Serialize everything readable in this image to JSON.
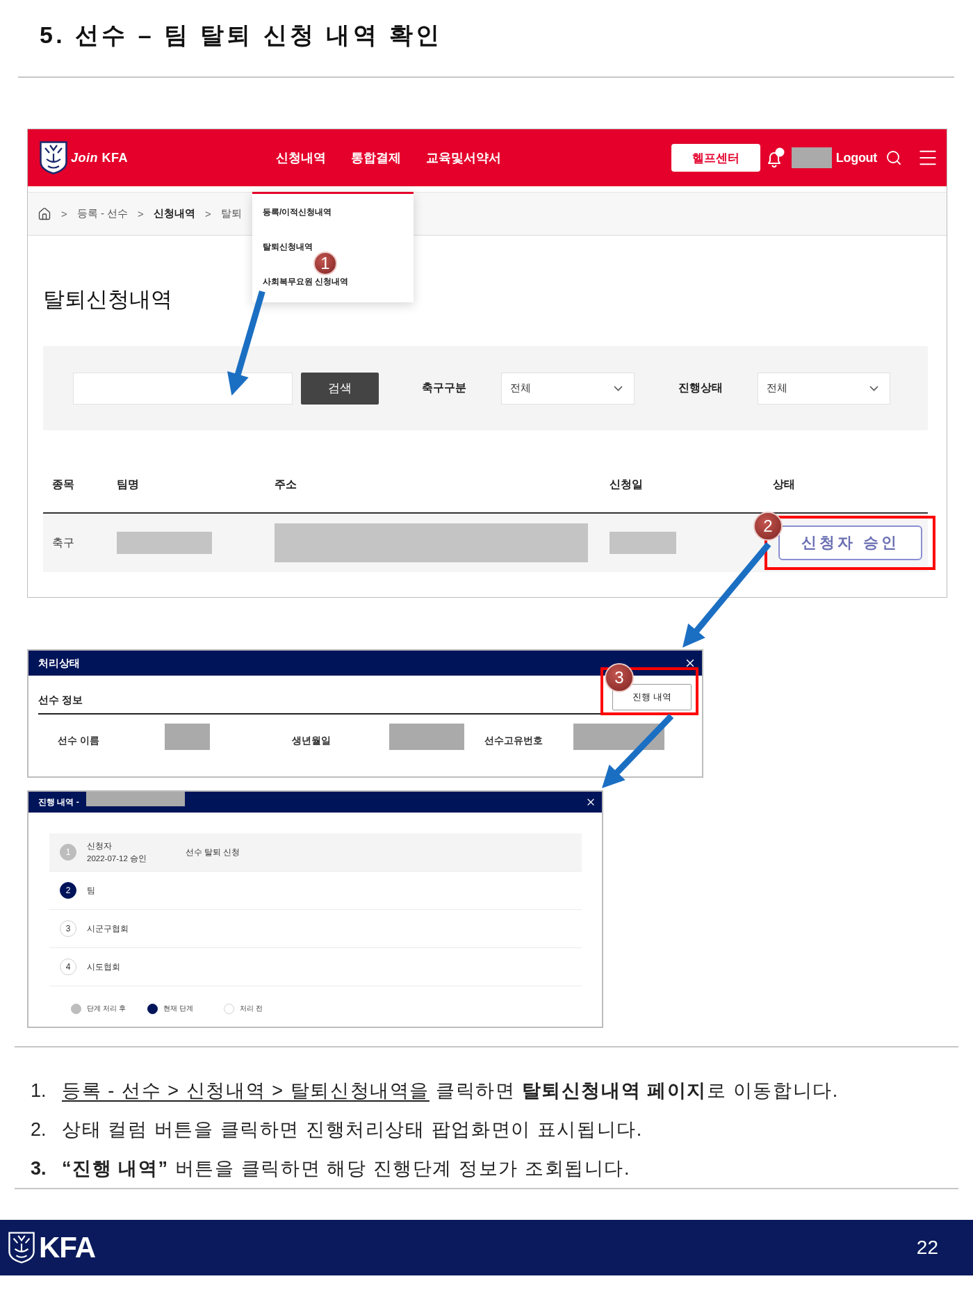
{
  "title": "5. 선수 – 팀 탈퇴 신청 내역 확인",
  "site": {
    "wordmark": "*Join* KFA",
    "nav": [
      {
        "label": "신청내역",
        "menu": [
          {
            "label": "등록/이적신청내역"
          },
          {
            "label": "탈퇴신청내역"
          },
          {
            "label": "사회복무요원 신청내역"
          }
        ],
        "marker": "1"
      },
      {
        "label": "통합결제"
      },
      {
        "label": "교육및서약서"
      }
    ],
    "help_button": "헬프센터",
    "user_redacted": true,
    "logout": "Logout",
    "breadcrumb": {
      "separator": ">",
      "items": [
        {
          "label": "등록 - 선수",
          "current": false
        },
        {
          "label": "신청내역",
          "current": true
        },
        {
          "label": "탈퇴",
          "current": false
        }
      ]
    },
    "page_title": "탈퇴신청내역",
    "search": {
      "button": "검색",
      "filters": [
        {
          "label": "축구구분",
          "value": "전체"
        },
        {
          "label": "진행상태",
          "value": "전체"
        }
      ]
    },
    "table": {
      "columns": [
        "종목",
        "팀명",
        "주소",
        "신청일",
        "상태"
      ],
      "rows": [
        {
          "cells": [
            {
              "kind": "text",
              "text": "축구"
            },
            {
              "kind": "redacted"
            },
            {
              "kind": "redacted"
            },
            {
              "kind": "redacted"
            },
            {
              "kind": "button",
              "text": "신청자 승인",
              "highlighted": true,
              "marker": "2"
            }
          ]
        }
      ]
    }
  },
  "status_popup": {
    "title": "처리상태",
    "section_title": "선수 정보",
    "history_button": {
      "label": "진행 내역",
      "highlighted": true,
      "marker": "3"
    },
    "fields": [
      {
        "label": "선수 이름",
        "redacted": true
      },
      {
        "label": "생년월일",
        "redacted": true
      },
      {
        "label": "선수고유번호",
        "redacted": true
      }
    ]
  },
  "history_popup": {
    "title": "진행 내역 -",
    "title_redacted": true,
    "steps": [
      {
        "number": "1",
        "name": "신청자",
        "date": "2022-07-12 승인",
        "note": "선수 탈퇴 신청",
        "kind": "done"
      },
      {
        "number": "2",
        "name": "팀",
        "kind": "current"
      },
      {
        "number": "3",
        "name": "시군구협회",
        "kind": "pending"
      },
      {
        "number": "4",
        "name": "시도협회",
        "kind": "pending"
      }
    ],
    "legend": [
      {
        "label": "단계 처리 후",
        "kind": "done"
      },
      {
        "label": "현재 단계",
        "kind": "current"
      },
      {
        "label": "처리 전",
        "kind": "pending"
      }
    ]
  },
  "instructions": [
    {
      "number": "1.",
      "emphasized": false,
      "segments": [
        {
          "text": "등록 - 선수 > 신청내역 > 탈퇴신청내역을",
          "underline": true
        },
        {
          "text": " 클릭하면 **탈퇴신청내역 페이지**로 이동합니다.",
          "underline": false
        }
      ]
    },
    {
      "number": "2.",
      "emphasized": false,
      "segments": [
        {
          "text": "상태 컬럼 버튼을 클릭하면 진행처리상태 팝업화면이 표시됩니다.",
          "underline": false
        }
      ]
    },
    {
      "number": "3.",
      "emphasized": true,
      "segments": [
        {
          "text": "**“진행 내역”** 버튼을 클릭하면 해당 진행단계 정보가 조회됩니다.",
          "underline": false
        }
      ]
    }
  ],
  "footer": {
    "logo_text": "KFA",
    "page_number": "22"
  }
}
